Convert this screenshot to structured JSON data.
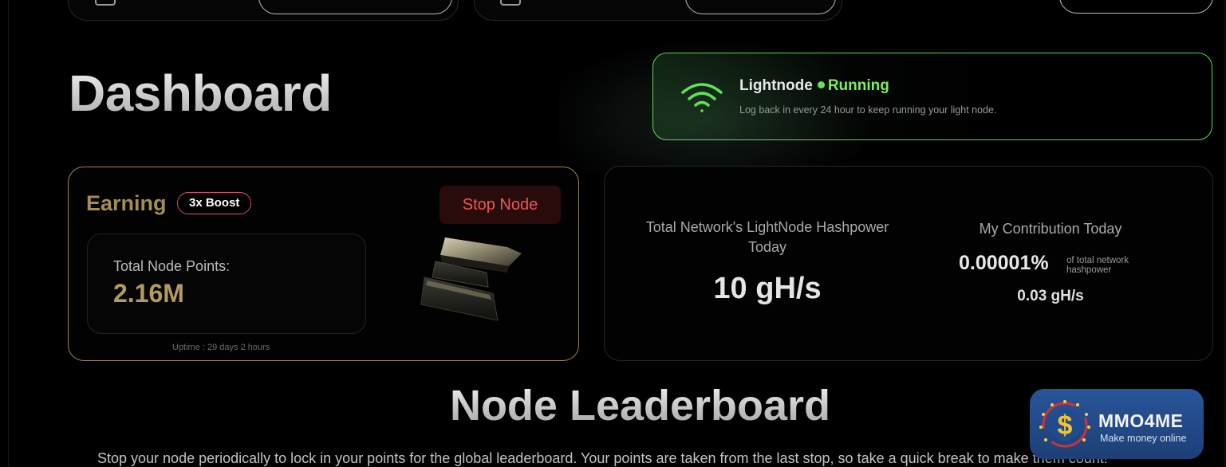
{
  "dashboard": {
    "title": "Dashboard"
  },
  "status": {
    "name": "Lightnode",
    "state": "Running",
    "note": "Log back in every 24 hour to keep running your light node.",
    "accent": "#7cf05e"
  },
  "earning": {
    "title": "Earning",
    "boost": "3x Boost",
    "stop_label": "Stop Node",
    "points_label": "Total Node Points:",
    "points_value": "2.16M",
    "uptime": "Uptime : 29 days 2 hours",
    "accent": "#a68c55"
  },
  "hashpower": {
    "network_label": "Total Network's LightNode Hashpower Today",
    "network_value": "10 gH/s",
    "my_label": "My Contribution Today",
    "my_percent": "0.00001%",
    "my_percent_note": "of total network hashpower",
    "my_value": "0.03 gH/s"
  },
  "leaderboard": {
    "title": "Node Leaderboard",
    "description": "Stop your node periodically to lock in your points for the global leaderboard. Your points are taken from the last stop, so take a quick break to make them count!"
  },
  "watermark": {
    "name": "MMO4ME",
    "tagline": "Make money online"
  }
}
